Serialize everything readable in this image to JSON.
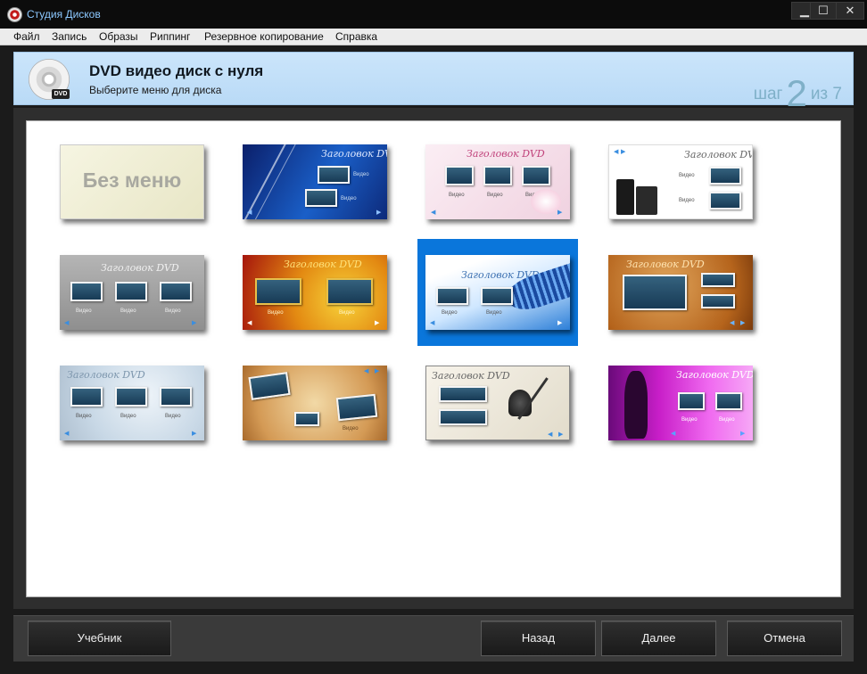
{
  "app": {
    "title": "Студия Дисков"
  },
  "window": {
    "minimize": "▁",
    "maximize": "☐",
    "close": "✕"
  },
  "menu": [
    "Файл",
    "Запись",
    "Образы",
    "Риппинг",
    "Резервное копирование",
    "Справка"
  ],
  "header": {
    "title": "DVD видео диск с нуля",
    "subtitle": "Выберите меню для диска",
    "step_prefix": "шаг",
    "step_current": "2",
    "step_mid": "из",
    "step_total": "7"
  },
  "icons": {
    "dvd_badge": "DVD"
  },
  "templates": {
    "no_menu": "Без меню",
    "heading": "Заголовок DVD",
    "video": "Видео"
  },
  "buttons": {
    "tutorial": "Учебник",
    "back": "Назад",
    "next": "Далее",
    "cancel": "Отмена"
  },
  "colors": {
    "accent": "#0a76db",
    "header_bg": "#c6e2fb",
    "window_bg": "#1b1b1b"
  }
}
